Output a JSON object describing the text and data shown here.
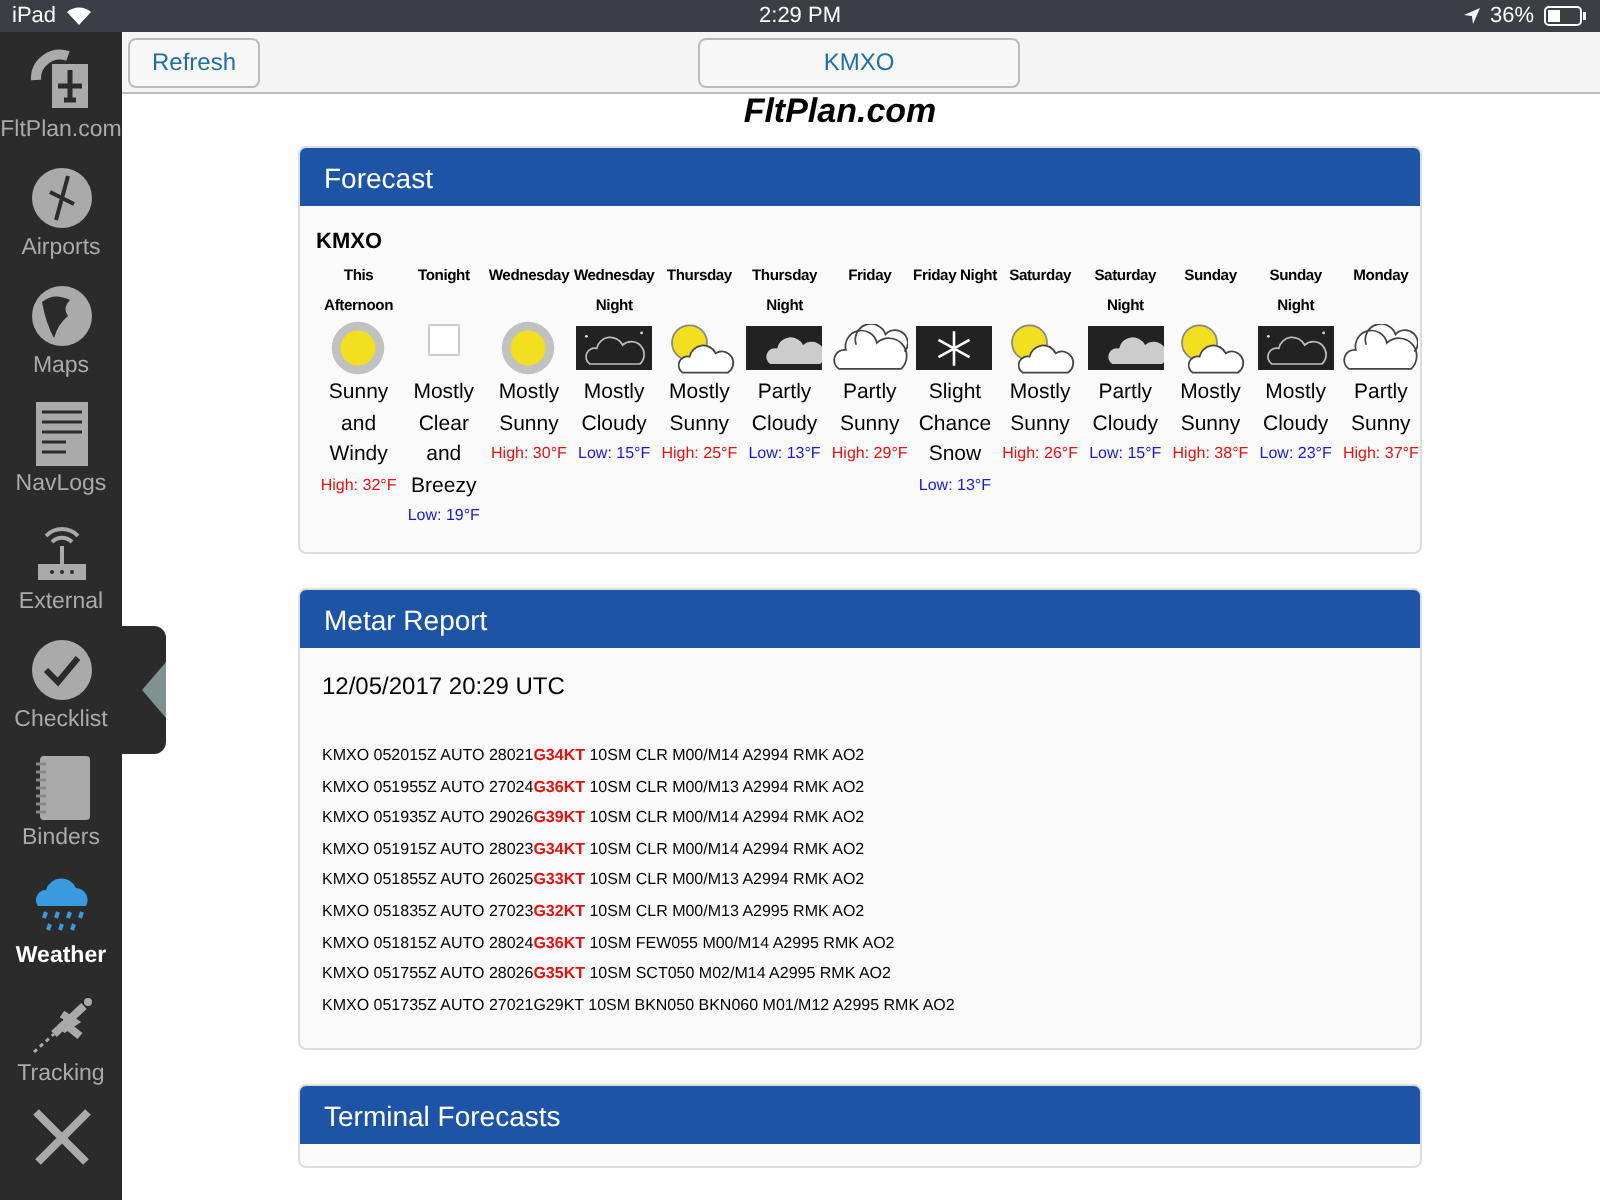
{
  "status_bar": {
    "device": "iPad",
    "time": "2:29 PM",
    "battery": "36%"
  },
  "sidebar": {
    "items": [
      {
        "label": "FltPlan.com",
        "selected": false
      },
      {
        "label": "Airports",
        "selected": false
      },
      {
        "label": "Maps",
        "selected": false
      },
      {
        "label": "NavLogs",
        "selected": false
      },
      {
        "label": "External",
        "selected": false
      },
      {
        "label": "Checklist",
        "selected": false
      },
      {
        "label": "Binders",
        "selected": false
      },
      {
        "label": "Weather",
        "selected": true
      },
      {
        "label": "Tracking",
        "selected": false
      }
    ]
  },
  "toolbar": {
    "refresh": "Refresh",
    "station": "KMXO"
  },
  "logo": "FltPlan.com",
  "forecast": {
    "title": "Forecast",
    "station": "KMXO",
    "periods": [
      {
        "name": "This Afternoon",
        "kind": "sun",
        "desc": "Sunny and Windy",
        "temp": {
          "text": "High: 32°F",
          "color": "#e8100e"
        }
      },
      {
        "name": "Tonight",
        "kind": "blank",
        "desc": "Mostly Clear and Breezy",
        "temp": {
          "text": "Low: 19°F",
          "color": "#1717e0"
        }
      },
      {
        "name": "Wednesday",
        "kind": "sun",
        "desc": "Mostly Sunny",
        "temp": {
          "text": "High: 30°F",
          "color": "#e8100e"
        }
      },
      {
        "name": "Wednesday Night",
        "kind": "nightcloud",
        "desc": "Mostly Cloudy",
        "temp": {
          "text": "Low: 15°F",
          "color": "#1717e0"
        }
      },
      {
        "name": "Thursday",
        "kind": "suncloud",
        "desc": "Mostly Sunny",
        "temp": {
          "text": "High: 25°F",
          "color": "#e8100e"
        }
      },
      {
        "name": "Thursday Night",
        "kind": "mooncloud",
        "desc": "Partly Cloudy",
        "temp": {
          "text": "Low: 13°F",
          "color": "#1717e0"
        }
      },
      {
        "name": "Friday",
        "kind": "clouds",
        "desc": "Partly Sunny",
        "temp": {
          "text": "High: 29°F",
          "color": "#e8100e"
        }
      },
      {
        "name": "Friday Night",
        "kind": "snow",
        "desc": "Slight Chance Snow",
        "temp": {
          "text": "Low: 13°F",
          "color": "#1717e0"
        }
      },
      {
        "name": "Saturday",
        "kind": "suncloud",
        "desc": "Mostly Sunny",
        "temp": {
          "text": "High: 26°F",
          "color": "#e8100e"
        }
      },
      {
        "name": "Saturday Night",
        "kind": "mooncloud",
        "desc": "Partly Cloudy",
        "temp": {
          "text": "Low: 15°F",
          "color": "#1717e0"
        }
      },
      {
        "name": "Sunday",
        "kind": "suncloud",
        "desc": "Mostly Sunny",
        "temp": {
          "text": "High: 38°F",
          "color": "#e8100e"
        }
      },
      {
        "name": "Sunday Night",
        "kind": "nightcloud",
        "desc": "Mostly Cloudy",
        "temp": {
          "text": "Low: 23°F",
          "color": "#1717e0"
        }
      },
      {
        "name": "Monday",
        "kind": "clouds",
        "desc": "Partly Sunny",
        "temp": {
          "text": "High: 37°F",
          "color": "#e8100e"
        }
      }
    ]
  },
  "metar": {
    "title": "Metar Report",
    "time": "12/05/2017 20:29 UTC",
    "lines": [
      "KMXO 052015Z AUTO 28021**G34KT** 10SM CLR M00/M14 A2994 RMK AO2",
      "KMXO 051955Z AUTO 27024**G36KT** 10SM CLR M00/M13 A2994 RMK AO2",
      "KMXO 051935Z AUTO 29026**G39KT** 10SM CLR M00/M14 A2994 RMK AO2",
      "KMXO 051915Z AUTO 28023**G34KT** 10SM CLR M00/M14 A2994 RMK AO2",
      "KMXO 051855Z AUTO 26025**G33KT** 10SM CLR M00/M13 A2994 RMK AO2",
      "KMXO 051835Z AUTO 27023**G32KT** 10SM CLR M00/M13 A2995 RMK AO2",
      "KMXO 051815Z AUTO 28024**G36KT** 10SM FEW055 M00/M14 A2995 RMK AO2",
      "KMXO 051755Z AUTO 28026**G35KT** 10SM SCT050 M02/M14 A2995 RMK AO2",
      "KMXO 051735Z AUTO 27021G29KT 10SM BKN050 BKN060 M01/M12 A2995 RMK AO2"
    ]
  },
  "terminal": {
    "title": "Terminal Forecasts"
  }
}
